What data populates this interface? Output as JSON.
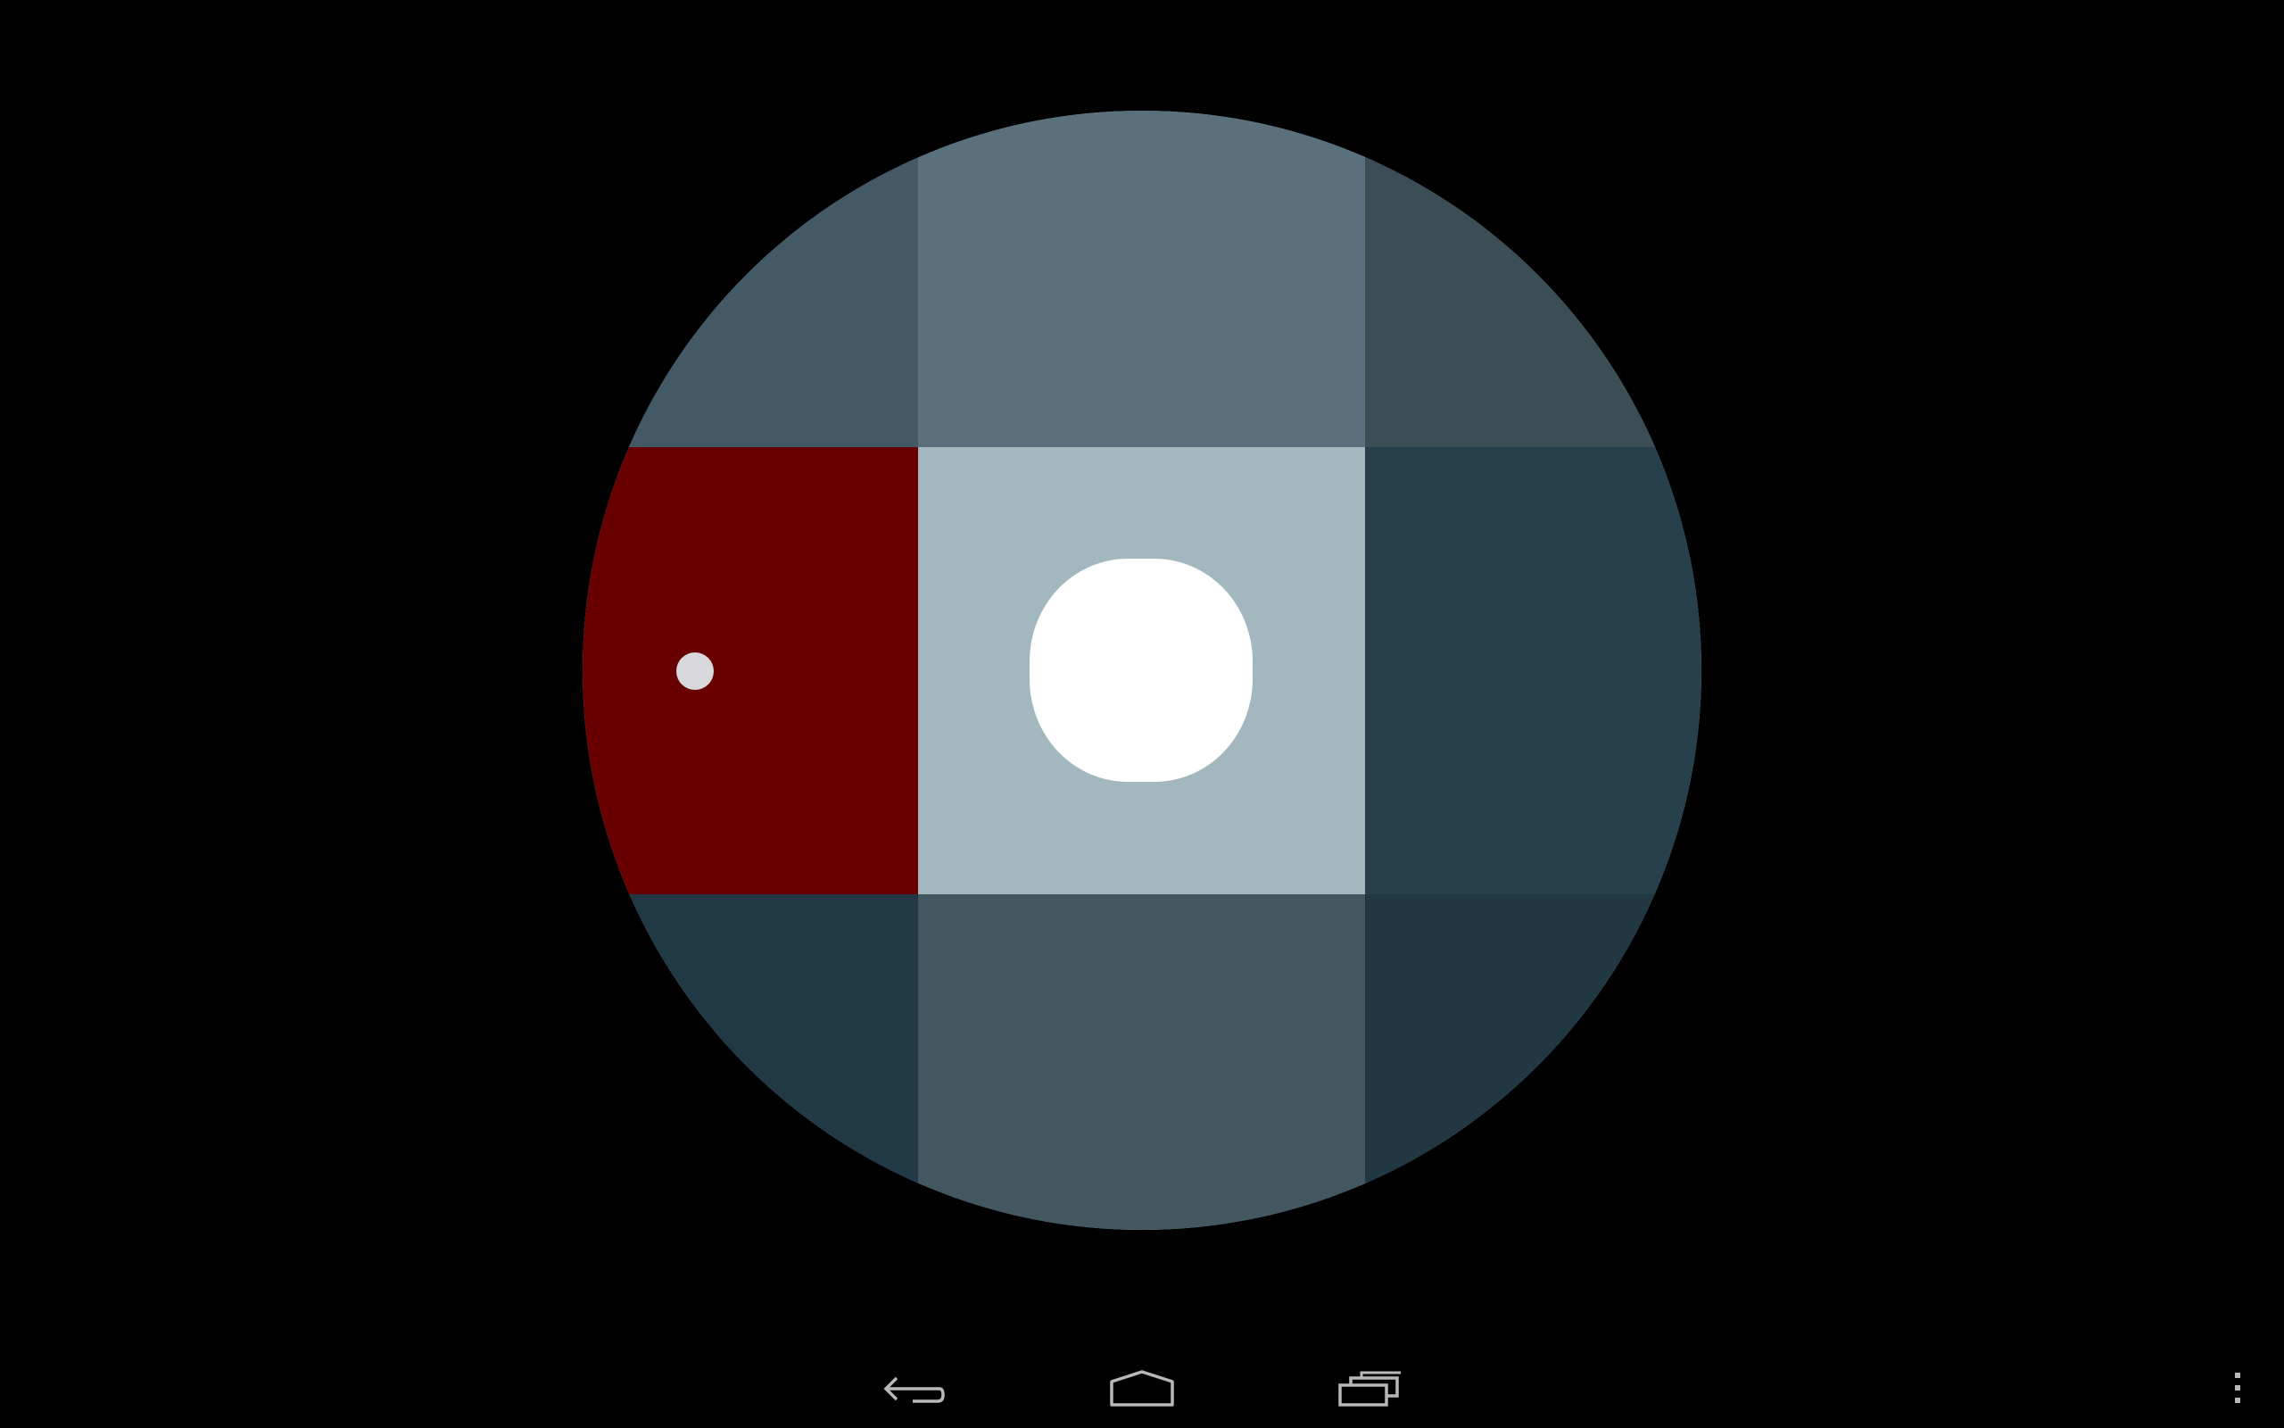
{
  "board": {
    "cells": [
      {
        "row": 0,
        "col": 0,
        "color": "#435a66"
      },
      {
        "row": 0,
        "col": 1,
        "color": "#5a717d"
      },
      {
        "row": 0,
        "col": 2,
        "color": "#3b4e56"
      },
      {
        "row": 1,
        "col": 0,
        "color": "#690000"
      },
      {
        "row": 1,
        "col": 1,
        "color": "#a3b7bf"
      },
      {
        "row": 1,
        "col": 2,
        "color": "#27404c"
      },
      {
        "row": 2,
        "col": 0,
        "color": "#213945"
      },
      {
        "row": 2,
        "col": 1,
        "color": "#42575f"
      },
      {
        "row": 2,
        "col": 2,
        "color": "#213742"
      }
    ],
    "player_dot_color": "#d8d8dc",
    "target_color": "#ffffff",
    "background": "#000000"
  },
  "navbar": {
    "icons": [
      "back-icon",
      "home-icon",
      "recent-apps-icon",
      "overflow-menu-icon"
    ],
    "icon_color": "#b8b8b8"
  }
}
